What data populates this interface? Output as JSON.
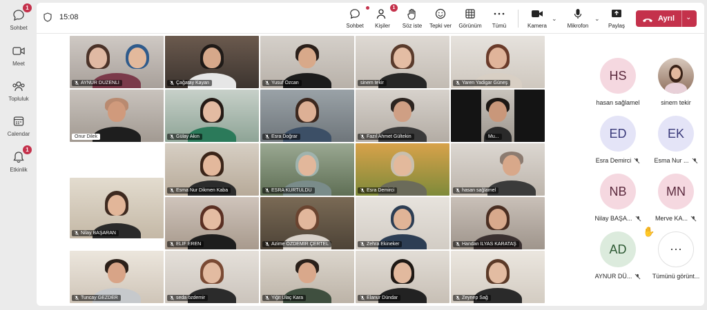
{
  "rail": [
    {
      "label": "Sohbet",
      "icon": "chat-icon",
      "badge": "1"
    },
    {
      "label": "Meet",
      "icon": "video-icon",
      "badge": ""
    },
    {
      "label": "Topluluk",
      "icon": "community-icon",
      "badge": ""
    },
    {
      "label": "Calendar",
      "icon": "calendar-icon",
      "badge": ""
    },
    {
      "label": "Etkinlik",
      "icon": "bell-icon",
      "badge": "1"
    }
  ],
  "header": {
    "time": "15:08",
    "actions": [
      {
        "label": "Sohbet",
        "icon": "chat-icon"
      },
      {
        "label": "Kişiler",
        "icon": "people-icon",
        "badge": "1"
      },
      {
        "label": "Söz iste",
        "icon": "raise-hand-icon"
      },
      {
        "label": "Tepki ver",
        "icon": "smile-icon"
      },
      {
        "label": "Görünüm",
        "icon": "grid-view-icon"
      },
      {
        "label": "Tümü",
        "icon": "more-icon"
      },
      {
        "label": "Kamera",
        "icon": "camera-icon"
      },
      {
        "label": "Mikrofon",
        "icon": "mic-icon"
      },
      {
        "label": "Paylaş",
        "icon": "share-icon"
      }
    ],
    "leave_label": "Ayrıl",
    "leave_color": "#c4314b"
  },
  "tiles": [
    {
      "name": "AYNUR DÜZENLİ"
    },
    {
      "name": "Çağatay Kayan"
    },
    {
      "name": "Yusuf Özcan"
    },
    {
      "name": "sinem tekir"
    },
    {
      "name": "Yaren Yadigar Güneş"
    },
    {
      "name": "Onur Dilek"
    },
    {
      "name": "Gülay Akın"
    },
    {
      "name": "Esra Doğrar"
    },
    {
      "name": "Fazıl Ahmet Gültekin"
    },
    {
      "name": "Mu..."
    },
    {
      "name": "Esma Nur Dikmen Kaba"
    },
    {
      "name": "ESRA KURTULDU"
    },
    {
      "name": "Esra Demirci"
    },
    {
      "name": "hasan sağlamel"
    },
    {
      "name": "Nilay BAŞARAN"
    },
    {
      "name": "ELİF EREN"
    },
    {
      "name": "Azime ÖZDEMİR ÇERTEL"
    },
    {
      "name": "Zehra Ekineker"
    },
    {
      "name": "Handan İLYAS KARATAŞ"
    },
    {
      "name": "Tuncay GEZDER"
    },
    {
      "name": "seda özdemir"
    },
    {
      "name": "Yiğit Ulaç Kara"
    },
    {
      "name": "Elanur Dündar"
    },
    {
      "name": "Zeynep Sağ"
    }
  ],
  "roster": [
    {
      "initials": "HS",
      "name": "hasan sağlamel",
      "muted": false
    },
    {
      "initials": "",
      "name": "sinem tekir",
      "muted": false
    },
    {
      "initials": "ED",
      "name": "Esra Demirci",
      "muted": true
    },
    {
      "initials": "EK",
      "name": "Esma Nur ...",
      "muted": true
    },
    {
      "initials": "NB",
      "name": "Nilay BAŞA...",
      "muted": true
    },
    {
      "initials": "MN",
      "name": "Merve KA...",
      "muted": true
    },
    {
      "initials": "AD",
      "name": "AYNUR DÜ...",
      "muted": true
    },
    {
      "initials": "",
      "name": "Tümünü görünt...",
      "muted": false
    }
  ]
}
